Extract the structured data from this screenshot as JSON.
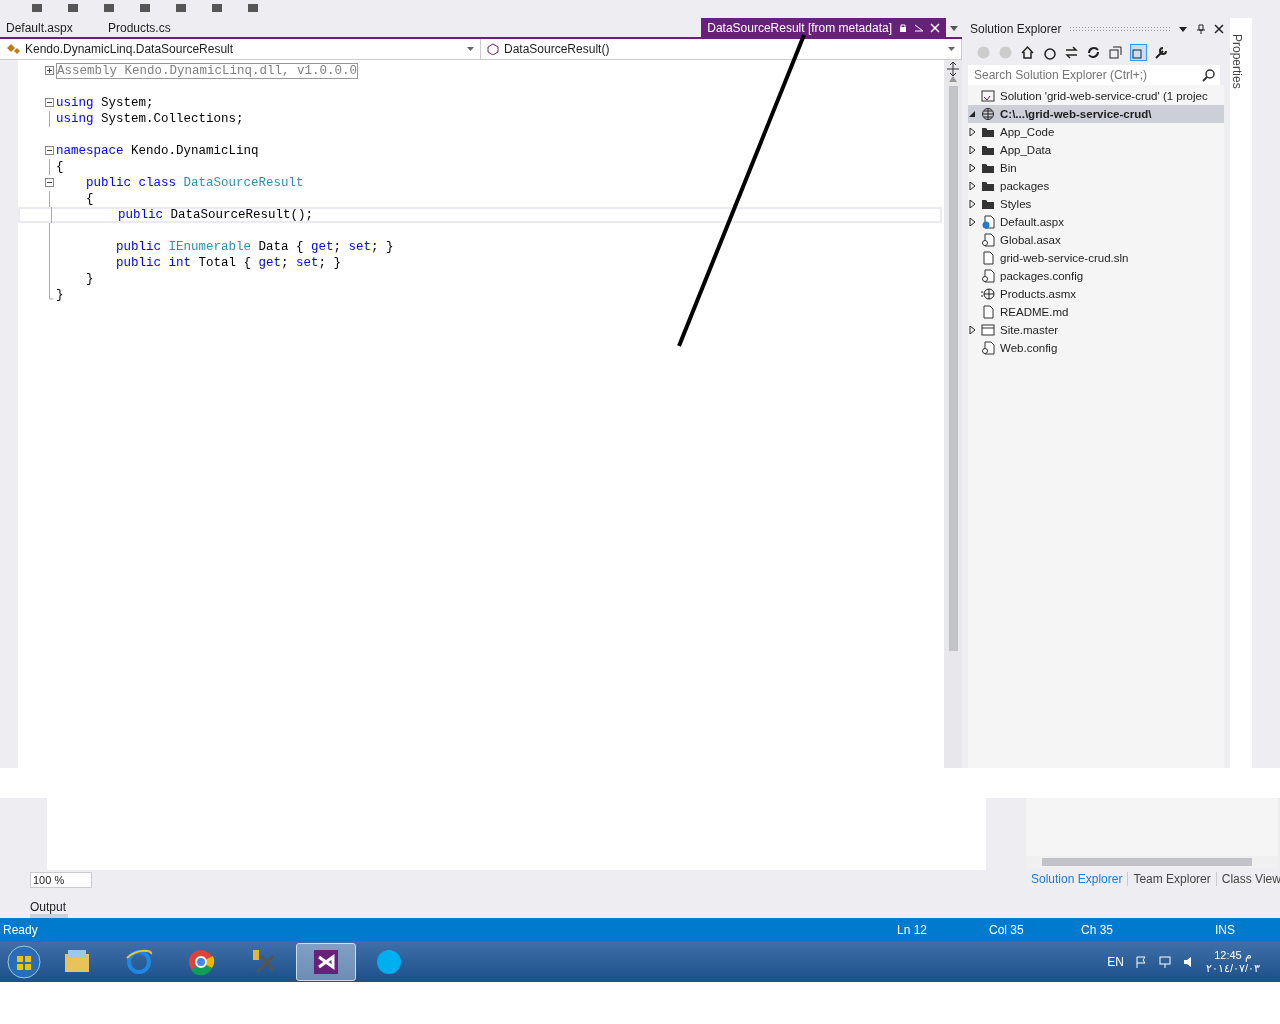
{
  "doc_tabs": [
    {
      "label": "Default.aspx",
      "selected": false
    },
    {
      "label": "Products.cs",
      "selected": false
    },
    {
      "label": "DataSourceResult [from metadata]",
      "selected": true
    }
  ],
  "nav_bar": {
    "type_dropdown": "Kendo.DynamicLinq.DataSourceResult",
    "member_dropdown": "DataSourceResult()"
  },
  "code": {
    "lines": [
      {
        "segments": [
          {
            "text": "Assembly Kendo.DynamicLinq.dll, v1.0.0.0",
            "kind": "collapsed"
          }
        ],
        "current": false
      },
      {
        "current": false
      },
      {
        "segments": [
          {
            "text": "using",
            "kind": "keyword"
          },
          {
            "text": " System;",
            "kind": "plain"
          }
        ],
        "current": false
      },
      {
        "segments": [
          {
            "text": "using",
            "kind": "keyword"
          },
          {
            "text": " System.Collections;",
            "kind": "plain"
          }
        ],
        "current": false
      },
      {
        "current": false
      },
      {
        "segments": [
          {
            "text": "namespace",
            "kind": "keyword"
          },
          {
            "text": " Kendo.DynamicLinq",
            "kind": "plain"
          }
        ],
        "current": false
      },
      {
        "segments": [
          {
            "text": "{",
            "kind": "plain"
          }
        ],
        "current": false
      },
      {
        "segments": [
          {
            "text": "    public class ",
            "kind": "keyword"
          },
          {
            "text": "DataSourceResult",
            "kind": "type"
          }
        ],
        "current": false
      },
      {
        "segments": [
          {
            "text": "    {",
            "kind": "plain"
          }
        ],
        "current": false
      },
      {
        "segments": [
          {
            "text": "        public",
            "kind": "keyword"
          },
          {
            "text": " DataSourceResult();",
            "kind": "plain"
          }
        ],
        "current": true
      },
      {
        "current": false
      },
      {
        "segments": [
          {
            "text": "        public ",
            "kind": "keyword"
          },
          {
            "text": "IEnumerable",
            "kind": "type"
          },
          {
            "text": " Data { ",
            "kind": "plain"
          },
          {
            "text": "get",
            "kind": "keyword"
          },
          {
            "text": "; ",
            "kind": "plain"
          },
          {
            "text": "set",
            "kind": "keyword"
          },
          {
            "text": "; }",
            "kind": "plain"
          }
        ],
        "current": false
      },
      {
        "segments": [
          {
            "text": "        public int",
            "kind": "keyword"
          },
          {
            "text": " Total { ",
            "kind": "plain"
          },
          {
            "text": "get",
            "kind": "keyword"
          },
          {
            "text": "; ",
            "kind": "plain"
          },
          {
            "text": "set",
            "kind": "keyword"
          },
          {
            "text": "; }",
            "kind": "plain"
          }
        ],
        "current": false
      },
      {
        "segments": [
          {
            "text": "    }",
            "kind": "plain"
          }
        ],
        "current": false
      },
      {
        "segments": [
          {
            "text": "}",
            "kind": "plain"
          }
        ],
        "current": false
      }
    ]
  },
  "solution_explorer": {
    "title": "Solution Explorer",
    "search": {
      "placeholder": "Search Solution Explorer (Ctrl+;)"
    },
    "tree": [
      {
        "label": "Solution 'grid-web-service-crud' (1 projec",
        "kind": "solution",
        "selected": false,
        "children": [
          {
            "label": "C:\\...\\grid-web-service-crud\\",
            "kind": "web",
            "expanded": true,
            "selected": true,
            "children": [
              {
                "label": "App_Code",
                "kind": "folder",
                "expanded": false,
                "selected": false
              },
              {
                "label": "App_Data",
                "kind": "folder",
                "expanded": false,
                "selected": false
              },
              {
                "label": "Bin",
                "kind": "folder",
                "expanded": false,
                "selected": false
              },
              {
                "label": "packages",
                "kind": "folder",
                "expanded": false,
                "selected": false
              },
              {
                "label": "Styles",
                "kind": "folder",
                "expanded": false,
                "selected": false
              },
              {
                "label": "Default.aspx",
                "kind": "page",
                "expanded": false,
                "selected": false
              },
              {
                "label": "Global.asax",
                "kind": "config",
                "selected": false
              },
              {
                "label": "grid-web-service-crud.sln",
                "kind": "file",
                "selected": false
              },
              {
                "label": "packages.config",
                "kind": "config",
                "selected": false
              },
              {
                "label": "Products.asmx",
                "kind": "service",
                "selected": false
              },
              {
                "label": "README.md",
                "kind": "file",
                "selected": false
              },
              {
                "label": "Site.master",
                "kind": "master",
                "expanded": false,
                "selected": false
              },
              {
                "label": "Web.config",
                "kind": "config",
                "selected": false
              }
            ]
          }
        ]
      }
    ],
    "bottom_tabs": [
      {
        "label": "Solution Explorer",
        "selected": true
      },
      {
        "label": "Team Explorer",
        "selected": false
      },
      {
        "label": "Class View",
        "selected": false
      }
    ]
  },
  "side_tab": "Properties",
  "zoom": "100 %",
  "output_tab": "Output",
  "status_bar": {
    "state": "Ready",
    "line": "Ln 12",
    "column": "Col 35",
    "char": "Ch 35",
    "mode": "INS"
  },
  "taskbar": {
    "apps": [
      {
        "kind": "explorer",
        "selected": false
      },
      {
        "kind": "ie",
        "selected": false
      },
      {
        "kind": "chrome",
        "selected": false
      },
      {
        "kind": "tools",
        "selected": false
      },
      {
        "kind": "vs",
        "selected": true
      },
      {
        "kind": "skype",
        "selected": false
      }
    ],
    "language": "EN",
    "time": "12:45 م",
    "date": "٢٠١٤/٠٧/٠٣"
  }
}
